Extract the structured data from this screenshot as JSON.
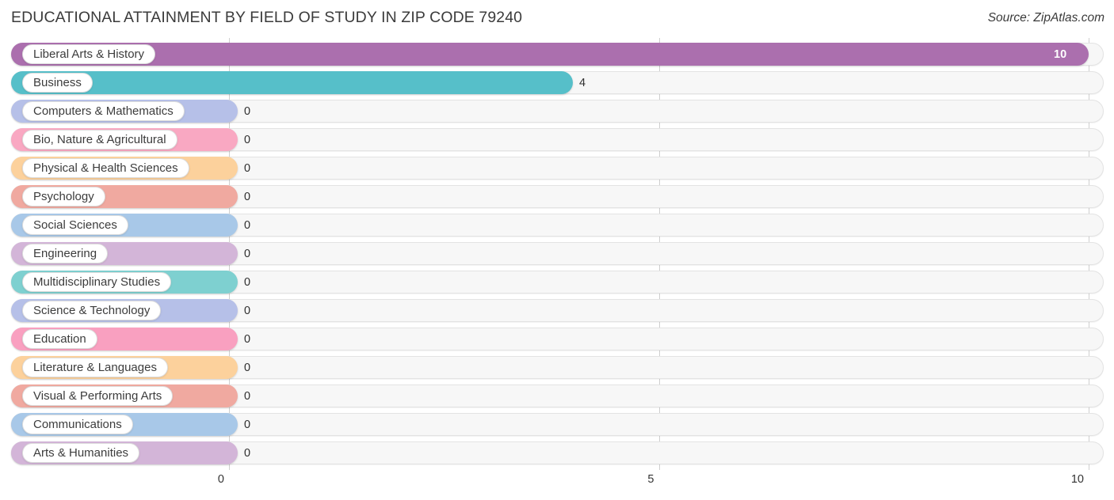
{
  "header": {
    "title": "EDUCATIONAL ATTAINMENT BY FIELD OF STUDY IN ZIP CODE 79240",
    "source": "Source: ZipAtlas.com"
  },
  "chart_data": {
    "type": "bar",
    "orientation": "horizontal",
    "title": "EDUCATIONAL ATTAINMENT BY FIELD OF STUDY IN ZIP CODE 79240",
    "xlabel": "",
    "ylabel": "",
    "xlim": [
      0,
      10
    ],
    "grid": true,
    "legend": "none",
    "ticks": [
      "0",
      "5",
      "10"
    ],
    "tick_values": [
      0,
      5,
      10
    ],
    "categories": [
      "Liberal Arts & History",
      "Business",
      "Computers & Mathematics",
      "Bio, Nature & Agricultural",
      "Physical & Health Sciences",
      "Psychology",
      "Social Sciences",
      "Engineering",
      "Multidisciplinary Studies",
      "Science & Technology",
      "Education",
      "Literature & Languages",
      "Visual & Performing Arts",
      "Communications",
      "Arts & Humanities"
    ],
    "values": [
      10,
      4,
      0,
      0,
      0,
      0,
      0,
      0,
      0,
      0,
      0,
      0,
      0,
      0,
      0
    ],
    "value_labels": [
      "10",
      "4",
      "0",
      "0",
      "0",
      "0",
      "0",
      "0",
      "0",
      "0",
      "0",
      "0",
      "0",
      "0",
      "0"
    ],
    "colors": [
      "#ab6fae",
      "#56bfc9",
      "#b6c0e8",
      "#f9a8c2",
      "#fcd19c",
      "#f0a9a0",
      "#a8c8e8",
      "#d3b5d8",
      "#7ed0d0",
      "#b6c0e8",
      "#f9a0c0",
      "#fcd19c",
      "#f0a9a0",
      "#a8c8e8",
      "#d3b5d8"
    ]
  },
  "style": {
    "track_color": "#f7f7f7",
    "grid_color": "#cfcfcf",
    "text_color": "#3b3b3b"
  }
}
